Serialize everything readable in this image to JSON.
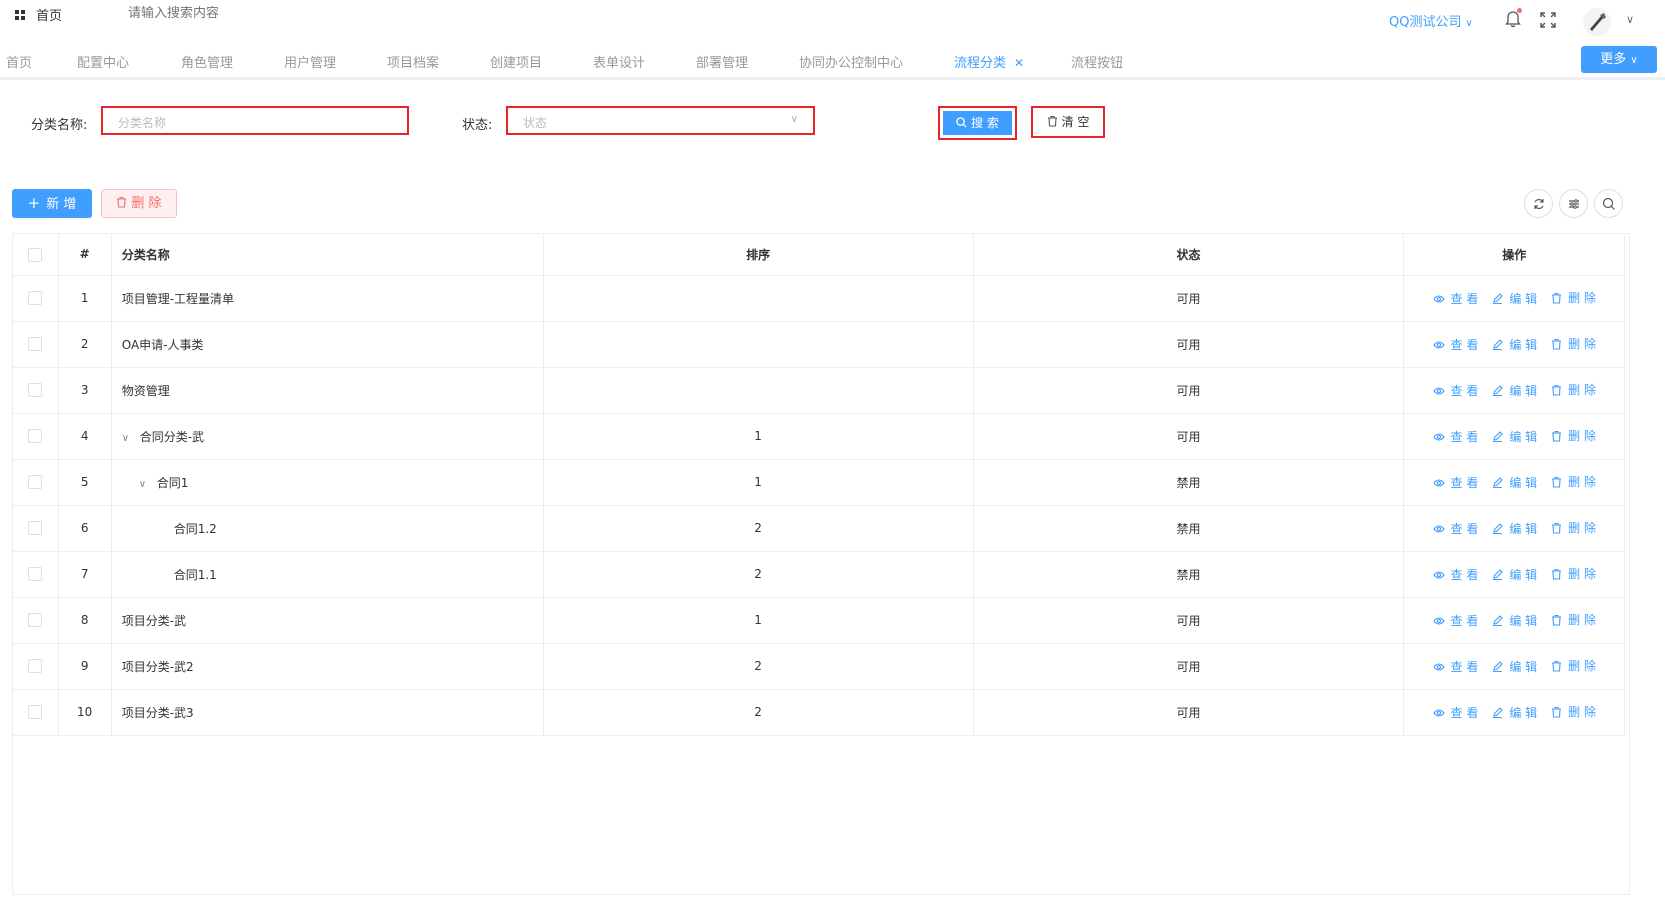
{
  "header": {
    "home_label": "首页",
    "search_placeholder": "请输入搜索内容",
    "company": "QQ测试公司"
  },
  "tabs": [
    {
      "label": "首页"
    },
    {
      "label": "配置中心"
    },
    {
      "label": "角色管理"
    },
    {
      "label": "用户管理"
    },
    {
      "label": "项目档案"
    },
    {
      "label": "创建项目"
    },
    {
      "label": "表单设计"
    },
    {
      "label": "部署管理"
    },
    {
      "label": "协同办公控制中心"
    },
    {
      "label": "流程分类",
      "active": true
    },
    {
      "label": "流程按钮"
    }
  ],
  "more_label": "更多",
  "filter": {
    "name_label": "分类名称:",
    "name_placeholder": "分类名称",
    "status_label": "状态:",
    "status_placeholder": "状态",
    "search_label": "搜 索",
    "clear_label": "清 空"
  },
  "toolbar": {
    "add_label": "新 增",
    "delete_label": "删 除"
  },
  "table": {
    "columns": [
      "#",
      "分类名称",
      "排序",
      "状态",
      "操作"
    ],
    "rows": [
      {
        "index": "1",
        "name": "项目管理-工程量清单",
        "level": 0,
        "expand": false,
        "order": "",
        "status": "可用"
      },
      {
        "index": "2",
        "name": "OA申请-人事类",
        "level": 0,
        "expand": false,
        "order": "",
        "status": "可用"
      },
      {
        "index": "3",
        "name": "物资管理",
        "level": 0,
        "expand": false,
        "order": "",
        "status": "可用"
      },
      {
        "index": "4",
        "name": "合同分类-武",
        "level": 0,
        "expand": true,
        "order": "1",
        "status": "可用"
      },
      {
        "index": "5",
        "name": "合同1",
        "level": 1,
        "expand": true,
        "order": "1",
        "status": "禁用"
      },
      {
        "index": "6",
        "name": "合同1.2",
        "level": 2,
        "expand": false,
        "order": "2",
        "status": "禁用"
      },
      {
        "index": "7",
        "name": "合同1.1",
        "level": 2,
        "expand": false,
        "order": "2",
        "status": "禁用"
      },
      {
        "index": "8",
        "name": "项目分类-武",
        "level": 0,
        "expand": false,
        "order": "1",
        "status": "可用"
      },
      {
        "index": "9",
        "name": "项目分类-武2",
        "level": 0,
        "expand": false,
        "order": "2",
        "status": "可用"
      },
      {
        "index": "10",
        "name": "项目分类-武3",
        "level": 0,
        "expand": false,
        "order": "2",
        "status": "可用"
      }
    ],
    "actions": {
      "view": "查 看",
      "edit": "编 辑",
      "delete": "删 除"
    }
  }
}
